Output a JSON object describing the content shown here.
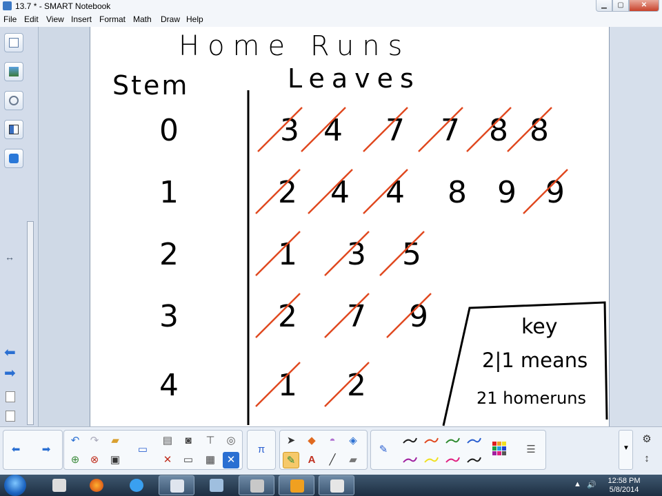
{
  "window": {
    "title": "13.7 * - SMART Notebook"
  },
  "menu": [
    "File",
    "Edit",
    "View",
    "Insert",
    "Format",
    "Math",
    "Draw",
    "Help"
  ],
  "sidebar": {
    "buttons": [
      "page-sorter",
      "gallery",
      "attachments",
      "properties",
      "add-ons"
    ]
  },
  "notes": {
    "title": "Home Runs",
    "stem_header": "Stem",
    "leaves_header": "Leaves",
    "rows": [
      {
        "stem": "0",
        "leaves": [
          "3",
          "4",
          "7",
          "7",
          "8",
          "8"
        ]
      },
      {
        "stem": "1",
        "leaves": [
          "2",
          "4",
          "4",
          "8",
          "9",
          "9"
        ]
      },
      {
        "stem": "2",
        "leaves": [
          "1",
          "3",
          "5"
        ]
      },
      {
        "stem": "3",
        "leaves": [
          "2",
          "7",
          "9"
        ]
      },
      {
        "stem": "4",
        "leaves": [
          "1",
          "2"
        ]
      }
    ],
    "key": {
      "title": "key",
      "line1": "2|1 means",
      "line2": "21 homeruns"
    },
    "ink_color": "#000000",
    "strike_color": "#e0481f"
  },
  "toolbar": {
    "pen_colors": [
      "#1a1a1a",
      "#e0481f",
      "#2f8a2f",
      "#2a5fd0",
      "#a020a0",
      "#f0e020",
      "#e02080",
      "#1a1a1a"
    ],
    "palette_icon": "color-grid-icon"
  },
  "taskbar": {
    "time": "12:58 PM",
    "date": "5/8/2014"
  }
}
